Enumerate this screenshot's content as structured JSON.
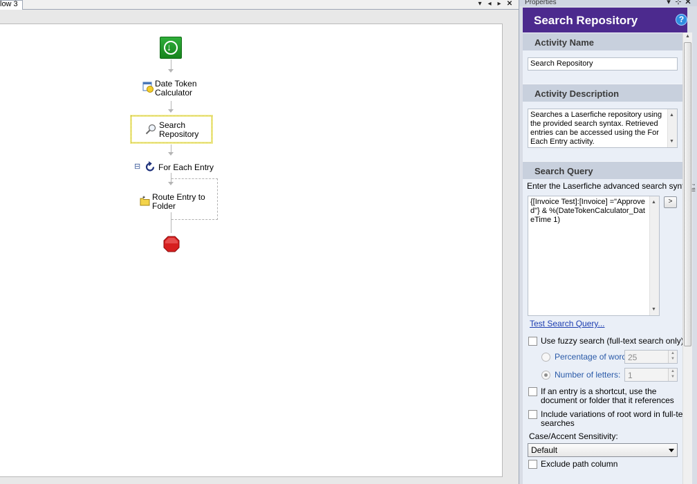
{
  "document_tab": {
    "label": "low 3"
  },
  "tab_controls": {
    "dropdown": "▾",
    "prev": "◂",
    "next": "▸",
    "close": "✕"
  },
  "workflow": {
    "activities": [
      {
        "label_line1": "Date Token",
        "label_line2": "Calculator",
        "icon": "calendar-clock-icon"
      },
      {
        "label_line1": "Search",
        "label_line2": "Repository",
        "icon": "magnifier-icon"
      },
      {
        "label_line1": "For Each Entry",
        "icon": "loop-icon"
      },
      {
        "label_line1": "Route Entry to",
        "label_line2": "Folder",
        "icon": "folder-icon"
      }
    ],
    "collapse_symbol": "⊟",
    "start_icon": "start-arrow-icon",
    "stop_icon": "stop-sign-icon"
  },
  "properties": {
    "pane_title": "Properties",
    "pane_controls": {
      "dropdown": "▾",
      "pin": "⊹",
      "close": "✕"
    },
    "header_title": "Search Repository",
    "help_symbol": "?",
    "sections": {
      "activity_name": "Activity Name",
      "activity_description": "Activity Description",
      "search_query": "Search Query"
    },
    "activity_name_value": "Search Repository",
    "activity_description_value": "Searches a Laserfiche repository using the provided search syntax.  Retrieved entries can be accessed using the For Each Entry activity.",
    "search_syntax_label": "Enter the Laserfiche advanced search syntax:",
    "search_query_value": "{[Invoice Test]:[Invoice] =\"Approved\"} & %(DateTokenCalculator_DateTime 1)",
    "insert_token_button": ">",
    "test_query_link": "Test Search Query...",
    "fuzzy_search_label": "Use fuzzy search (full-text search only)",
    "percentage_label": "Percentage of word:",
    "percentage_value": "25",
    "letters_label": "Number of letters:",
    "letters_value": "1",
    "shortcut_label_line1": "If an entry is a shortcut, use the",
    "shortcut_label_line2": "document or folder that it references",
    "variations_label_line1": "Include variations of root word in full-text",
    "variations_label_line2": "searches",
    "case_accent_label": "Case/Accent Sensitivity:",
    "case_accent_value": "Default",
    "exclude_path_label": "Exclude path column"
  },
  "colors": {
    "header_purple": "#4c2a8e",
    "start_green": "#2fae3a",
    "stop_red": "#d61f1f",
    "selection_yellow": "#f3ef97",
    "link_blue": "#1b3cb0"
  }
}
